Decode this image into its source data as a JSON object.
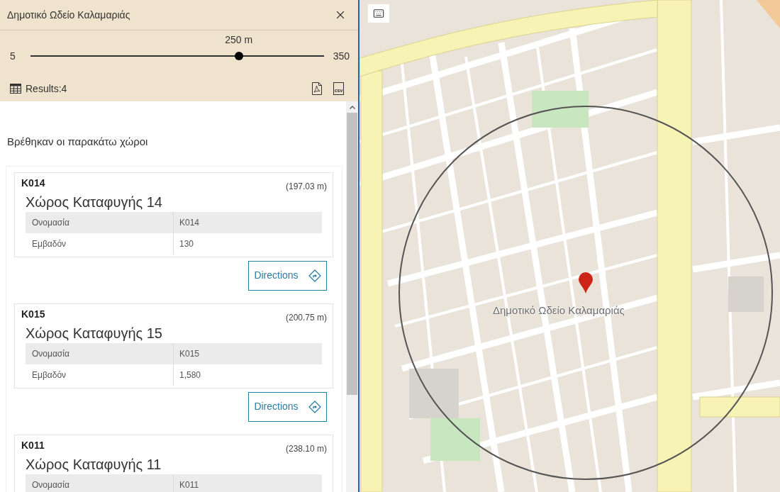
{
  "panel": {
    "title": "Δημοτικό Ωδείο Καλαμαριάς"
  },
  "distance_slider": {
    "min_label": "5",
    "max_label": "350",
    "reading": "250 m",
    "level": 0.71
  },
  "results": {
    "label": "Results:4",
    "csv_label": "csv"
  },
  "list_heading": "Βρέθηκαν οι παρακάτω χώροι",
  "places": [
    {
      "code": "K014",
      "distance": "(197.03 m)",
      "name": "Χώρος Καταφυγής 14",
      "fields": [
        {
          "label": "Ονομασία",
          "value": "K014"
        },
        {
          "label": "Εμβαδόν",
          "value": "130"
        }
      ],
      "action": "Directions"
    },
    {
      "code": "K015",
      "distance": "(200.75 m)",
      "name": "Χώρος Καταφυγής 15",
      "fields": [
        {
          "label": "Ονομασία",
          "value": "K015"
        },
        {
          "label": "Εμβαδόν",
          "value": "1,580"
        }
      ],
      "action": "Directions"
    },
    {
      "code": "K011",
      "distance": "(238.10 m)",
      "name": "Χώρος Καταφυγής 11",
      "fields": [
        {
          "label": "Ονομασία",
          "value": "K011"
        }
      ]
    }
  ],
  "map": {
    "marker_label": "Δημοτικό Ωδείο Καλαμαριάς"
  }
}
